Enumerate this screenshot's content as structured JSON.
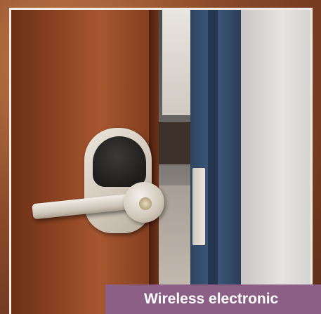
{
  "caption": {
    "text": "Wireless electronic",
    "background": "#8b5f86",
    "color": "#ffffff"
  },
  "photo": {
    "subject": "door-lock-photo"
  }
}
